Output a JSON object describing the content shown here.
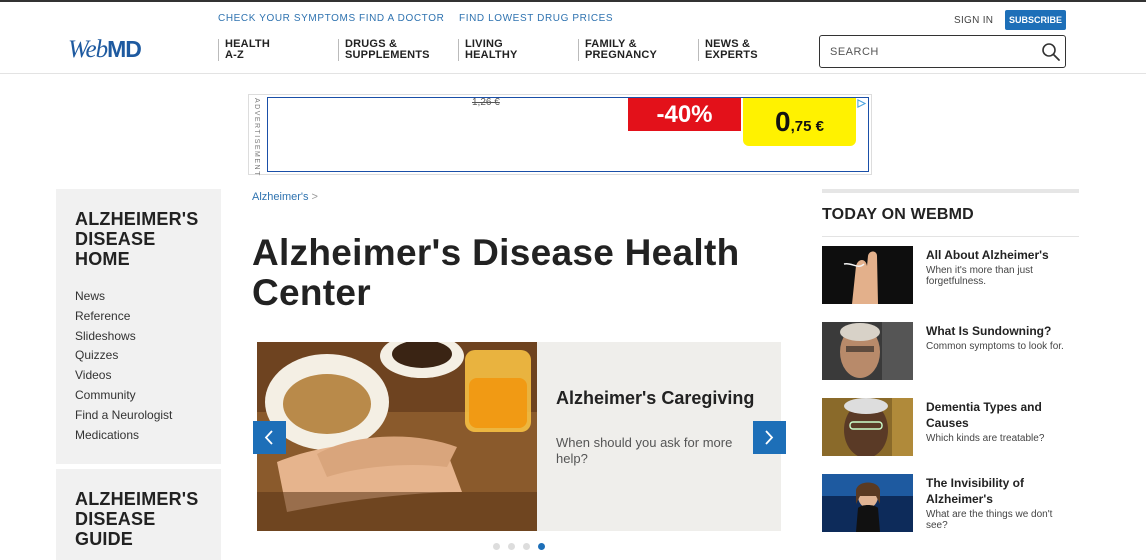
{
  "header": {
    "logo": {
      "web": "Web",
      "md": "MD"
    },
    "top_links": [
      "CHECK YOUR SYMPTOMS",
      "FIND A DOCTOR",
      "FIND LOWEST DRUG PRICES"
    ],
    "nav": [
      {
        "line1": "HEALTH",
        "line2": "A-Z"
      },
      {
        "line1": "DRUGS &",
        "line2": "SUPPLEMENTS"
      },
      {
        "line1": "LIVING",
        "line2": "HEALTHY"
      },
      {
        "line1": "FAMILY &",
        "line2": "PREGNANCY"
      },
      {
        "line1": "NEWS &",
        "line2": "EXPERTS"
      }
    ],
    "sign_in": "SIGN IN",
    "subscribe": "SUBSCRIBE",
    "search_placeholder": "SEARCH"
  },
  "ad": {
    "label": "ADVERTISEMENT",
    "old_price": "1,26 €",
    "discount": "-40%",
    "price_big": "0",
    "price_small": ",75 €"
  },
  "sidebar": {
    "home_title": "ALZHEIMER'S DISEASE HOME",
    "links": [
      "News",
      "Reference",
      "Slideshows",
      "Quizzes",
      "Videos",
      "Community",
      "Find a Neurologist",
      "Medications"
    ],
    "guide_title": "ALZHEIMER'S DISEASE GUIDE"
  },
  "main": {
    "breadcrumb": "Alzheimer's",
    "breadcrumb_sep": ">",
    "title": "Alzheimer's Disease Health Center",
    "carousel": {
      "title": "Alzheimer's Caregiving",
      "description": "When should you ask for more help?",
      "active_slide": 4,
      "slide_count": 4
    }
  },
  "today": {
    "heading": "TODAY ON WEBMD",
    "stories": [
      {
        "title": "All About Alzheimer's",
        "desc": "When it's more than just forgetfulness."
      },
      {
        "title": "What Is Sundowning?",
        "desc": "Common symptoms to look for."
      },
      {
        "title": "Dementia Types and Causes",
        "desc": "Which kinds are treatable?"
      },
      {
        "title": "The Invisibility of Alzheimer's",
        "desc": "What are the things we don't see?"
      }
    ]
  },
  "colors": {
    "brand_blue": "#1d6fb8",
    "link_blue": "#2f73b0",
    "ad_red": "#e3111a",
    "ad_yellow": "#fff200"
  }
}
